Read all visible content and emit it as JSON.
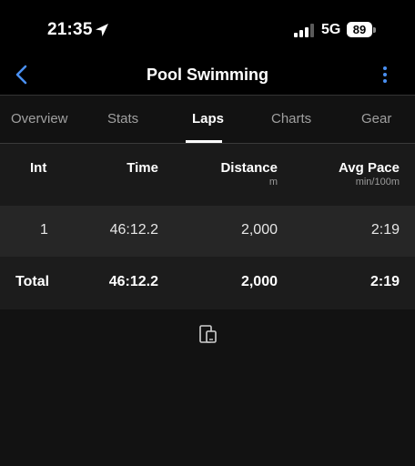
{
  "status_bar": {
    "time": "21:35",
    "network": "5G",
    "battery": "89"
  },
  "nav": {
    "title": "Pool Swimming",
    "back_icon": "chevron-left-icon",
    "more_icon": "vertical-ellipsis-icon"
  },
  "tabs": [
    {
      "label": "Overview",
      "active": false
    },
    {
      "label": "Stats",
      "active": false
    },
    {
      "label": "Laps",
      "active": true
    },
    {
      "label": "Charts",
      "active": false
    },
    {
      "label": "Gear",
      "active": false
    }
  ],
  "table": {
    "headers": {
      "int": "Int",
      "time": "Time",
      "distance": "Distance",
      "distance_unit": "m",
      "avg_pace": "Avg Pace",
      "avg_pace_unit": "min/100m"
    },
    "rows": [
      {
        "int": "1",
        "time": "46:12.2",
        "distance": "2,000",
        "avg_pace": "2:19"
      }
    ],
    "total": {
      "label": "Total",
      "time": "46:12.2",
      "distance": "2,000",
      "avg_pace": "2:19"
    }
  },
  "colors": {
    "accent": "#4a90f2",
    "background": "#121212"
  }
}
